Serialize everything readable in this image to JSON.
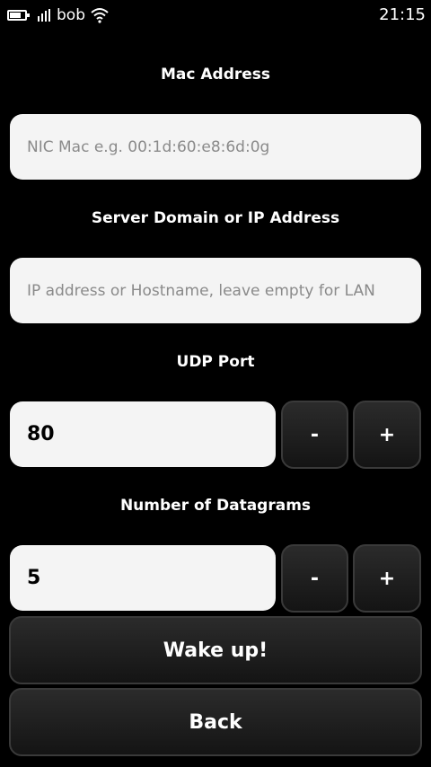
{
  "status_bar": {
    "operator": "bob",
    "time": "21:15",
    "battery_level": 0.75,
    "signal_bars": 4
  },
  "mac_address": {
    "label": "Mac Address",
    "placeholder": "NIC Mac e.g. 00:1d:60:e8:6d:0g",
    "value": ""
  },
  "server": {
    "label": "Server Domain or IP Address",
    "placeholder": "IP address or Hostname, leave empty for LAN",
    "value": ""
  },
  "udp_port": {
    "label": "UDP Port",
    "value": "80",
    "decrement_label": "-",
    "increment_label": "+"
  },
  "datagrams": {
    "label": "Number of Datagrams",
    "value": "5",
    "decrement_label": "-",
    "increment_label": "+"
  },
  "actions": {
    "wake_label": "Wake up!",
    "back_label": "Back"
  }
}
